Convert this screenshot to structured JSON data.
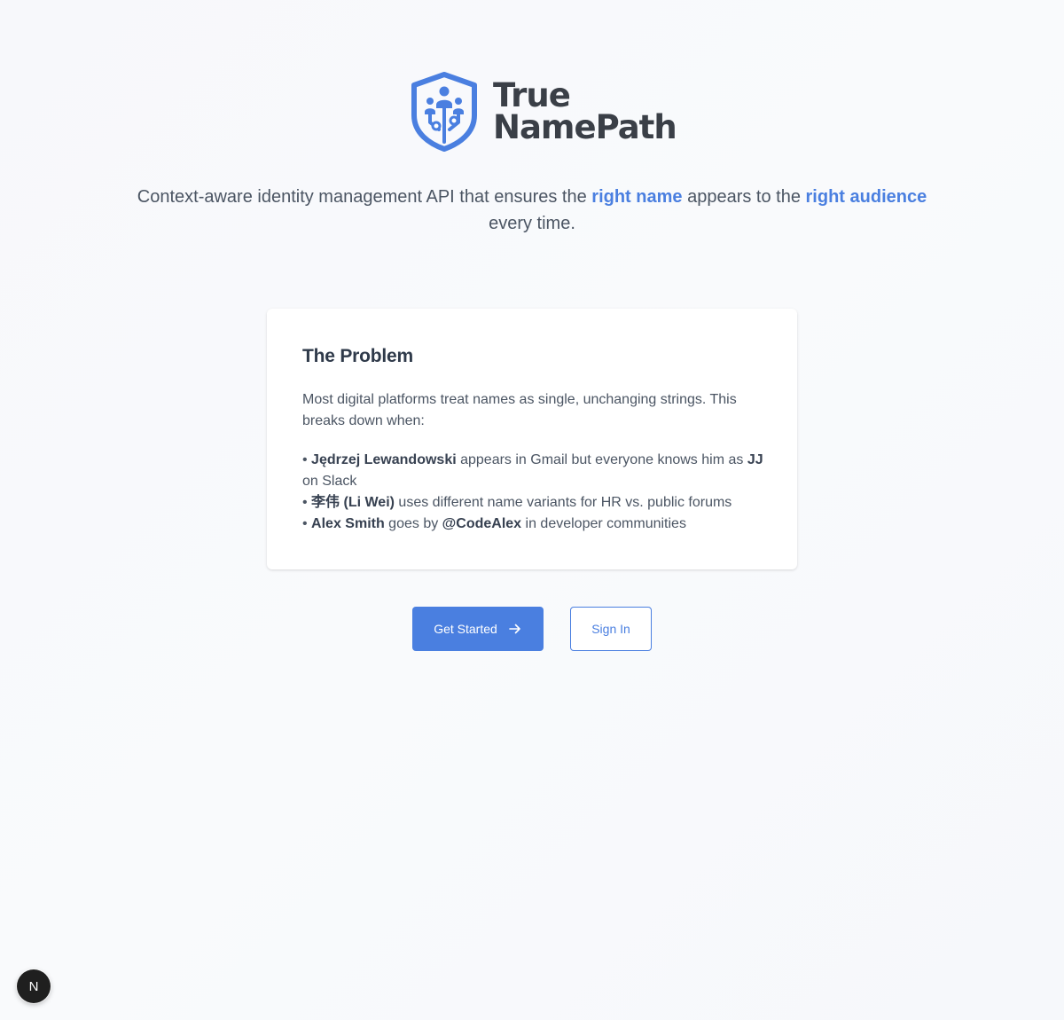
{
  "brand": {
    "name_line1": "True",
    "name_line2": "NamePath",
    "logo_icon": "shield-network-icon",
    "accent": "#4a7fe0"
  },
  "tagline": {
    "part1": "Context-aware identity management API that ensures the ",
    "highlight1": "right name",
    "part2": " appears to the ",
    "highlight2": "right audience",
    "part3": " every time."
  },
  "problem": {
    "title": "The Problem",
    "intro": "Most digital platforms treat names as single, unchanging strings. This breaks down when:",
    "items": [
      {
        "bullet": "• ",
        "name": "Jędrzej Lewandowski",
        "text1": " appears in Gmail but everyone knows him as ",
        "alias": "JJ",
        "text2": " on Slack"
      },
      {
        "bullet": "• ",
        "name": "李伟 (Li Wei)",
        "text1": " uses different name variants for HR vs. public forums"
      },
      {
        "bullet": "• ",
        "name": "Alex Smith",
        "text1": " goes by ",
        "alias": "@CodeAlex",
        "text2": " in developer communities"
      }
    ]
  },
  "actions": {
    "get_started": "Get Started",
    "get_started_icon": "arrow-right-icon",
    "sign_in": "Sign In"
  },
  "dev_badge": {
    "letter": "N",
    "icon": "nextjs-icon"
  }
}
